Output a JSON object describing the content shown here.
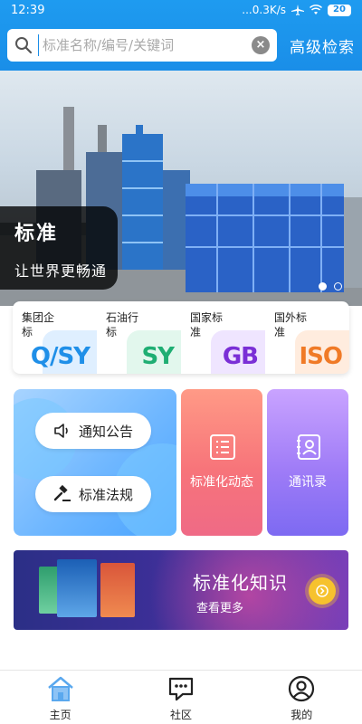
{
  "status_bar": {
    "time": "12:39",
    "network": "...0.3K/s",
    "battery": "20"
  },
  "search": {
    "placeholder": "标准名称/编号/关键词",
    "advanced_label": "高级检索"
  },
  "banner": {
    "title": "标准",
    "subtitle": "让世界更畅通",
    "active_slide": 1,
    "slide_count": 2
  },
  "categories": [
    {
      "label": "集团企标",
      "code": "Q/SY",
      "color": "#1f8fe8",
      "tint": "#bfe0ff"
    },
    {
      "label": "石油行标",
      "code": "SY",
      "color": "#1fae73",
      "tint": "#c5f0dc"
    },
    {
      "label": "国家标准",
      "code": "GB",
      "color": "#7a2fd6",
      "tint": "#e0ccff"
    },
    {
      "label": "国外标准",
      "code": "ISO",
      "color": "#f07a26",
      "tint": "#ffd9bd"
    }
  ],
  "features": {
    "notice": "通知公告",
    "regulations": "标准法规",
    "dynamics": "标准化动态",
    "contacts": "通讯录"
  },
  "knowledge": {
    "title": "标准化知识",
    "more": "查看更多"
  },
  "nav": {
    "home": "主页",
    "community": "社区",
    "mine": "我的"
  },
  "colors": {
    "brand": "#1a8ee8",
    "nav_active": "#5aa8ee"
  }
}
